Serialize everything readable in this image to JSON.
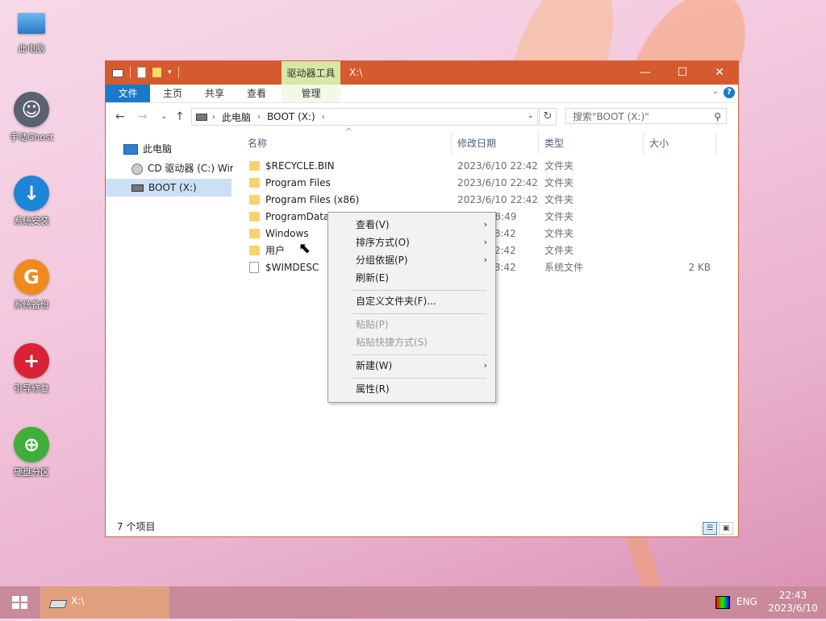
{
  "desktop": {
    "icons": [
      {
        "label": "此电脑",
        "icon": "computer-icon"
      },
      {
        "label": "手动Ghost",
        "icon": "ghost-icon"
      },
      {
        "label": "系统安装",
        "icon": "install-arrow-icon"
      },
      {
        "label": "系统备份",
        "icon": "backup-g-icon"
      },
      {
        "label": "引导修复",
        "icon": "repair-plus-icon"
      },
      {
        "label": "硬盘分区",
        "icon": "partition-icon"
      }
    ]
  },
  "window": {
    "title": "X:\\",
    "context_tab": "驱动器工具",
    "controls": {
      "minimize": "—",
      "maximize": "☐",
      "close": "✕"
    },
    "ribbon_tabs": [
      "文件",
      "主页",
      "共享",
      "查看",
      "管理"
    ],
    "address": {
      "crumbs": [
        "此电脑",
        "BOOT (X:)"
      ]
    },
    "search_placeholder": "搜索\"BOOT (X:)\"",
    "nav_items": [
      {
        "label": "此电脑",
        "icon": "pc-icon"
      },
      {
        "label": "CD 驱动器 (C:) Wir",
        "icon": "cd-icon"
      },
      {
        "label": "BOOT (X:)",
        "icon": "drive-icon",
        "selected": true
      }
    ],
    "columns": [
      "名称",
      "修改日期",
      "类型",
      "大小"
    ],
    "files": [
      {
        "name": "$RECYCLE.BIN",
        "date": "2023/6/10 22:42",
        "type": "文件夹",
        "size": "",
        "icon": "folder-icon"
      },
      {
        "name": "Program Files",
        "date": "2023/6/10 22:42",
        "type": "文件夹",
        "size": "",
        "icon": "folder-icon"
      },
      {
        "name": "Program Files (x86)",
        "date": "2023/6/10 22:42",
        "type": "文件夹",
        "size": "",
        "icon": "folder-icon"
      },
      {
        "name": "ProgramData",
        "date": "7 8:49",
        "type": "文件夹",
        "size": "",
        "icon": "folder-icon"
      },
      {
        "name": "Windows",
        "date": "18 18:42",
        "type": "文件夹",
        "size": "",
        "icon": "folder-icon"
      },
      {
        "name": "用户",
        "date": "10 22:42",
        "type": "文件夹",
        "size": "",
        "icon": "folder-icon"
      },
      {
        "name": "$WIMDESC",
        "date": "18 18:42",
        "type": "系统文件",
        "size": "2 KB",
        "icon": "file-icon"
      }
    ],
    "status": "7 个项目"
  },
  "context_menu": {
    "items": [
      {
        "label": "查看(V)",
        "submenu": true,
        "disabled": false
      },
      {
        "label": "排序方式(O)",
        "submenu": true,
        "disabled": false
      },
      {
        "label": "分组依据(P)",
        "submenu": true,
        "disabled": false
      },
      {
        "label": "刷新(E)",
        "submenu": false,
        "disabled": false
      },
      {
        "label": "自定义文件夹(F)...",
        "submenu": false,
        "disabled": false
      },
      {
        "label": "粘贴(P)",
        "submenu": false,
        "disabled": true
      },
      {
        "label": "粘贴快捷方式(S)",
        "submenu": false,
        "disabled": true
      },
      {
        "label": "新建(W)",
        "submenu": true,
        "disabled": false
      },
      {
        "label": "属性(R)",
        "submenu": false,
        "disabled": false
      }
    ]
  },
  "taskbar": {
    "app_title": "X:\\",
    "language": "ENG",
    "time": "22:43",
    "date": "2023/6/10"
  },
  "colors": {
    "titlebar": "#d55a2d",
    "context_tab": "#d6e8a5",
    "file_tab": "#1979ca"
  }
}
